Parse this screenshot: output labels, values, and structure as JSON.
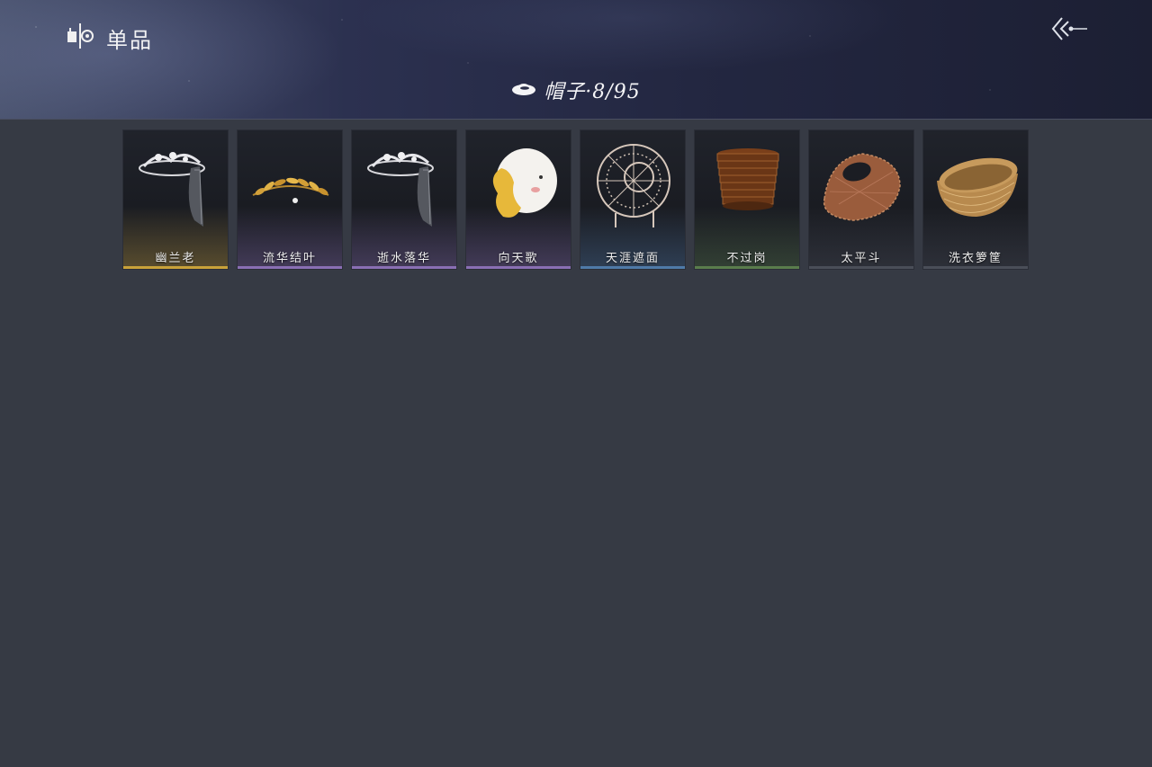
{
  "header": {
    "section_title": "单品",
    "section_icon": "wardrobe-icon",
    "back_icon": "back-arrow-icon",
    "category_icon": "hat-icon",
    "category_label": "帽子·8/95"
  },
  "items": [
    {
      "name": "幽兰老",
      "rarity_color": "#c9a23a",
      "art": "silver-crown-with-veil"
    },
    {
      "name": "流华结叶",
      "rarity_color": "#8a6fb4",
      "art": "golden-leaf-circlet"
    },
    {
      "name": "逝水落华",
      "rarity_color": "#8a6fb4",
      "art": "silver-crown-with-veil"
    },
    {
      "name": "向天歌",
      "rarity_color": "#8a6fb4",
      "art": "duck-hood"
    },
    {
      "name": "天涯遮面",
      "rarity_color": "#4f7aa8",
      "art": "wire-frame-hat"
    },
    {
      "name": "不过岗",
      "rarity_color": "#5a7d4c",
      "art": "stacked-bowls-hat"
    },
    {
      "name": "太平斗",
      "rarity_color": "#4a4e58",
      "art": "woven-bamboo-hat"
    },
    {
      "name": "洗衣箩筐",
      "rarity_color": "#4a4e58",
      "art": "wicker-basket"
    }
  ]
}
